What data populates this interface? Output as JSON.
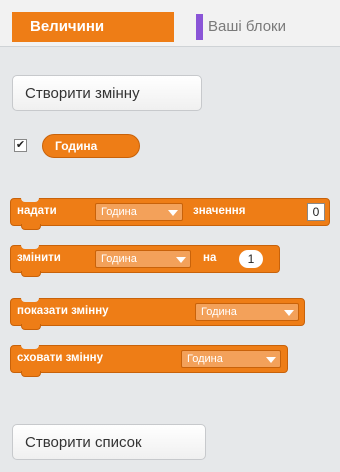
{
  "tabs": {
    "variables": "Величини",
    "my_blocks": "Ваші блоки"
  },
  "buttons": {
    "make_variable": "Створити змінну",
    "make_list": "Створити список"
  },
  "variable": {
    "name": "Година",
    "checked": true
  },
  "blocks": {
    "set": {
      "label": "надати",
      "var": "Година",
      "label2": "значення",
      "value": "0"
    },
    "change": {
      "label": "змінити",
      "var": "Година",
      "label2": "на",
      "value": "1"
    },
    "show": {
      "label": "показати змінну",
      "var": "Година"
    },
    "hide": {
      "label": "сховати змінну",
      "var": "Година"
    }
  },
  "colors": {
    "variables_category": "#ee7d16",
    "my_blocks_category": "#8a55d7"
  }
}
